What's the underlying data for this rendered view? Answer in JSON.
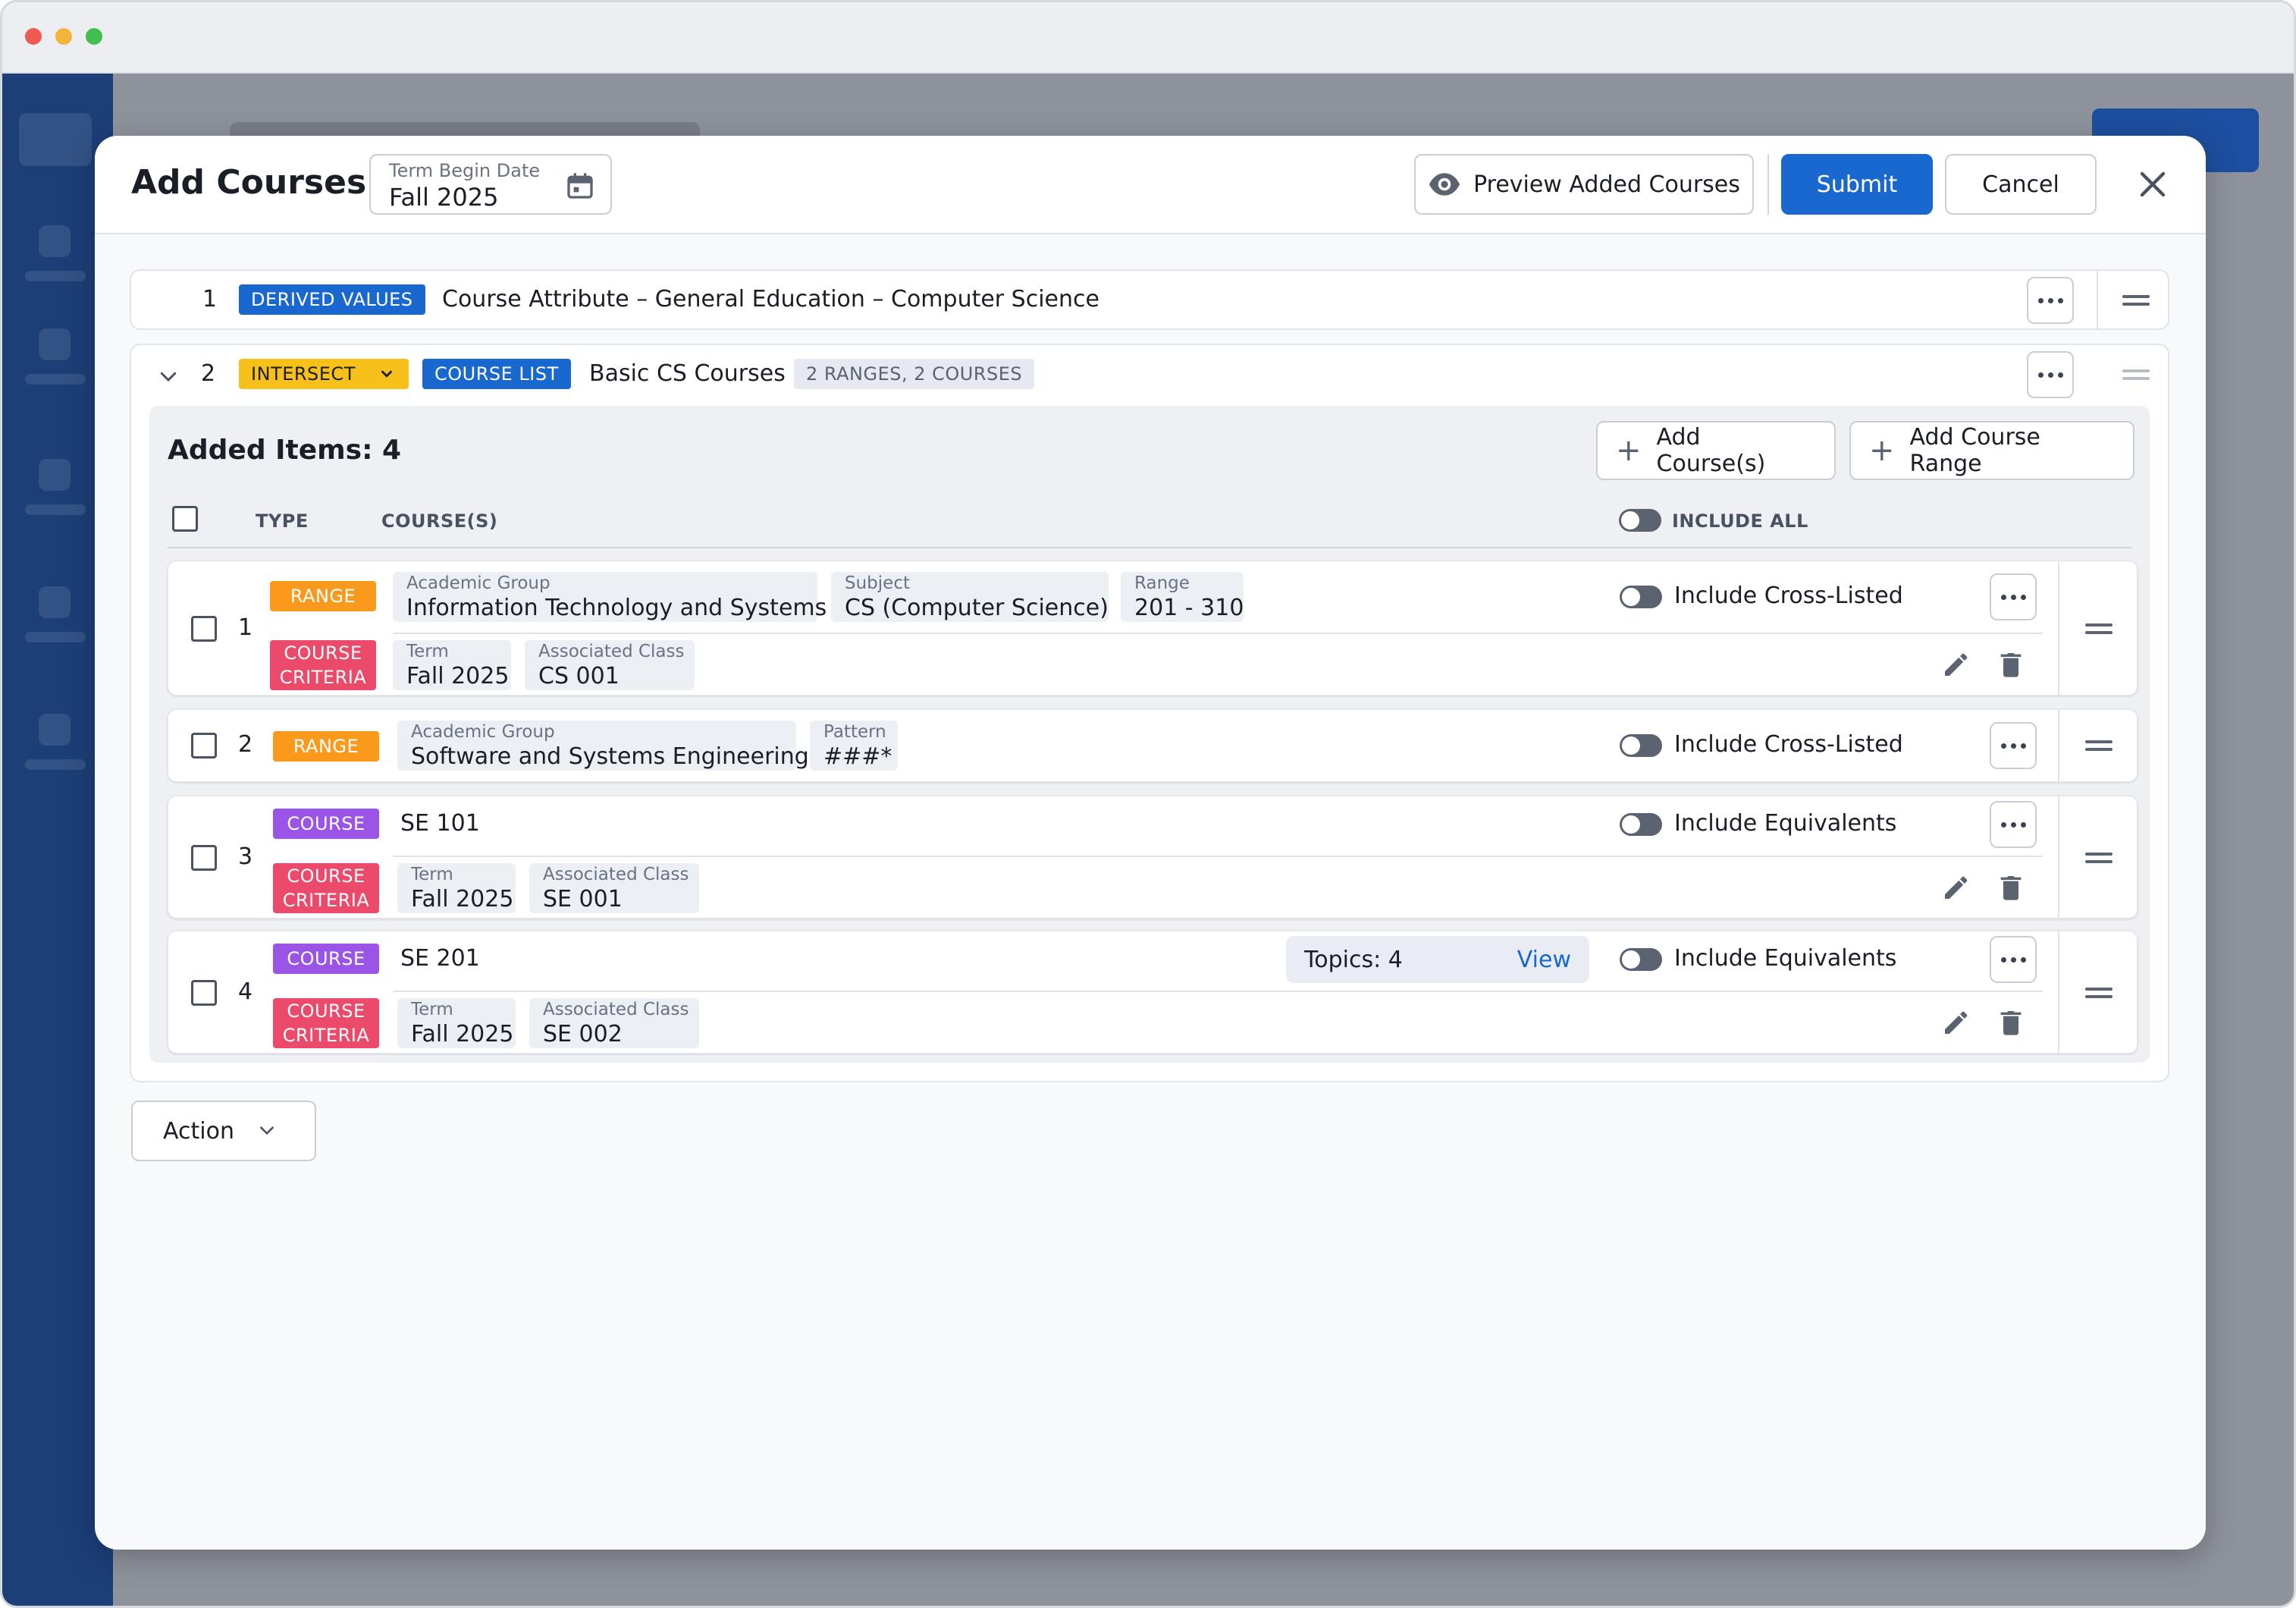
{
  "modal": {
    "title": "Add Courses",
    "term_field": {
      "label": "Term Begin Date",
      "value": "Fall 2025"
    },
    "preview_button": "Preview Added Courses",
    "submit_button": "Submit",
    "cancel_button": "Cancel"
  },
  "rows": [
    {
      "number": "1",
      "tag": "DERIVED VALUES",
      "text": "Course Attribute –  General Education – Computer Science"
    },
    {
      "number": "2",
      "operator": "INTERSECT",
      "tag": "COURSE LIST",
      "text": "Basic CS Courses",
      "summary": "2 RANGES, 2 COURSES"
    }
  ],
  "added_items": {
    "title": "Added Items: 4",
    "add_course_button": "Add Course(s)",
    "add_range_button": "Add Course Range",
    "columns": {
      "type": "TYPE",
      "courses": "COURSE(S)",
      "include_all": "INCLUDE ALL"
    },
    "items": [
      {
        "number": "1",
        "type_tag": "RANGE",
        "criteria_tag": [
          "COURSE",
          "CRITERIA"
        ],
        "fields": [
          {
            "label": "Academic Group",
            "value": "Information Technology and Systems"
          },
          {
            "label": "Subject",
            "value": "CS (Computer Science)"
          },
          {
            "label": "Range",
            "value": "201 - 310"
          }
        ],
        "criteria": [
          {
            "label": "Term",
            "value": "Fall 2025"
          },
          {
            "label": "Associated Class",
            "value": "CS 001"
          }
        ],
        "toggle_label": "Include Cross-Listed"
      },
      {
        "number": "2",
        "type_tag": "RANGE",
        "fields": [
          {
            "label": "Academic Group",
            "value": "Software and Systems Engineering"
          },
          {
            "label": "Pattern",
            "value": "###*"
          }
        ],
        "toggle_label": "Include Cross-Listed"
      },
      {
        "number": "3",
        "type_tag": "COURSE",
        "course": "SE 101",
        "criteria_tag": [
          "COURSE",
          "CRITERIA"
        ],
        "criteria": [
          {
            "label": "Term",
            "value": "Fall 2025"
          },
          {
            "label": "Associated Class",
            "value": "SE 001"
          }
        ],
        "toggle_label": "Include Equivalents"
      },
      {
        "number": "4",
        "type_tag": "COURSE",
        "course": "SE 201",
        "topics": {
          "label": "Topics: 4",
          "link": "View"
        },
        "criteria_tag": [
          "COURSE",
          "CRITERIA"
        ],
        "criteria": [
          {
            "label": "Term",
            "value": "Fall 2025"
          },
          {
            "label": "Associated Class",
            "value": "SE 002"
          }
        ],
        "toggle_label": "Include Equivalents"
      }
    ]
  },
  "action_button": "Action",
  "icons": {
    "calendar": "calendar-icon",
    "preview": "eye-icon",
    "close": "close-icon",
    "more": "more-horizontal-icon",
    "drag": "drag-handle-icon",
    "edit": "pencil-icon",
    "delete": "trash-icon",
    "chevron": "chevron-down-icon",
    "add": "plus-icon"
  },
  "colors": {
    "primary": "#1868d0",
    "tag_yellow": "#f7c01a",
    "tag_orange": "#f99a1c",
    "tag_red": "#ec4a6b",
    "tag_purple": "#9b55e6",
    "app_sidebar": "#1c3f78"
  }
}
